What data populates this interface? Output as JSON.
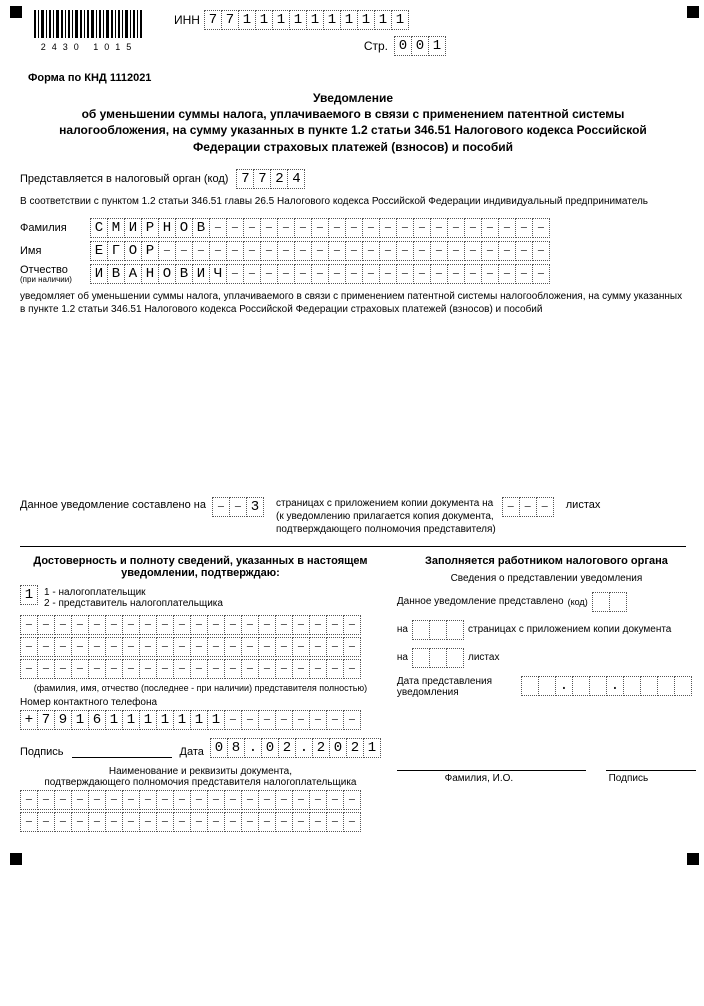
{
  "header": {
    "barcode_nums": "2430  1015",
    "inn_label": "ИНН",
    "inn": [
      "7",
      "7",
      "1",
      "1",
      "1",
      "1",
      "1",
      "1",
      "1",
      "1",
      "1",
      "1"
    ],
    "page_label": "Стр.",
    "page": [
      "0",
      "0",
      "1"
    ]
  },
  "form_code": "Форма по КНД 1112021",
  "title_line1": "Уведомление",
  "title_rest": "об уменьшении суммы налога, уплачиваемого в связи с применением патентной системы налогообложения, на сумму указанных в пункте 1.2 статьи 346.51 Налогового кодекса Российской Федерации страховых платежей (взносов) и пособий",
  "authority": {
    "label": "Представляется в налоговый орган (код)",
    "code": [
      "7",
      "7",
      "2",
      "4"
    ]
  },
  "basis": "В соответствии с пунктом 1.2 статьи 346.51 главы 26.5 Налогового кодекса Российской Федерации индивидуальный предприниматель",
  "person": {
    "surname_label": "Фамилия",
    "surname": [
      "С",
      "М",
      "И",
      "Р",
      "Н",
      "О",
      "В"
    ],
    "name_label": "Имя",
    "name": [
      "Е",
      "Г",
      "О",
      "Р"
    ],
    "patronymic_label": "Отчество",
    "patronymic_sub": "(при наличии)",
    "patronymic": [
      "И",
      "В",
      "А",
      "Н",
      "О",
      "В",
      "И",
      "Ч"
    ]
  },
  "name_cells_count": 27,
  "notice_text": "уведомляет об уменьшении суммы налога, уплачиваемого в связи с применением патентной системы налогообложения, на сумму указанных в пункте 1.2 статьи 346.51 Налогового кодекса Российской Федерации страховых платежей (взносов) и пособий",
  "composed": {
    "label": "Данное уведомление составлено на",
    "pages": [
      "",
      "",
      "3"
    ],
    "desc1": "страницах с приложением копии документа на",
    "desc2": "(к уведомлению прилагается копия документа,",
    "desc3": "подтверждающего полномочия представителя)",
    "sheets": [
      "",
      "",
      ""
    ],
    "sheets_label": "листах"
  },
  "left_col": {
    "title": "Достоверность и полноту сведений, указанных в настоящем уведомлении, подтверждаю:",
    "declarant_code": "1",
    "opt1": "1 - налогоплательщик",
    "opt2": "2 - представитель налогоплательщика",
    "rep_cells_count": 20,
    "rep_note": "(фамилия, имя, отчество (последнее - при наличии) представителя полностью)",
    "phone_label": "Номер контактного телефона",
    "phone": [
      "+",
      "7",
      "9",
      "1",
      "6",
      "1",
      "1",
      "1",
      "1",
      "1",
      "1",
      "1"
    ],
    "phone_cells_count": 20,
    "sign_label": "Подпись",
    "date_label": "Дата",
    "date": [
      "0",
      "8",
      ".",
      "0",
      "2",
      ".",
      "2",
      "0",
      "2",
      "1"
    ],
    "doc_name_line1": "Наименование и реквизиты документа,",
    "doc_name_line2": "подтверждающего полномочия представителя налогоплательщика"
  },
  "right_col": {
    "title": "Заполняется работником налогового органа",
    "sub": "Сведения о представлении уведомления",
    "line1_label": "Данное уведомление представлено",
    "code_label": "(код)",
    "line2_prefix": "на",
    "line2_suffix": "страницах с приложением копии документа",
    "line3_prefix": "на",
    "line3_suffix": "листах",
    "date_label": "Дата представления уведомления",
    "fio_label": "Фамилия, И.О.",
    "sign_label": "Подпись"
  }
}
